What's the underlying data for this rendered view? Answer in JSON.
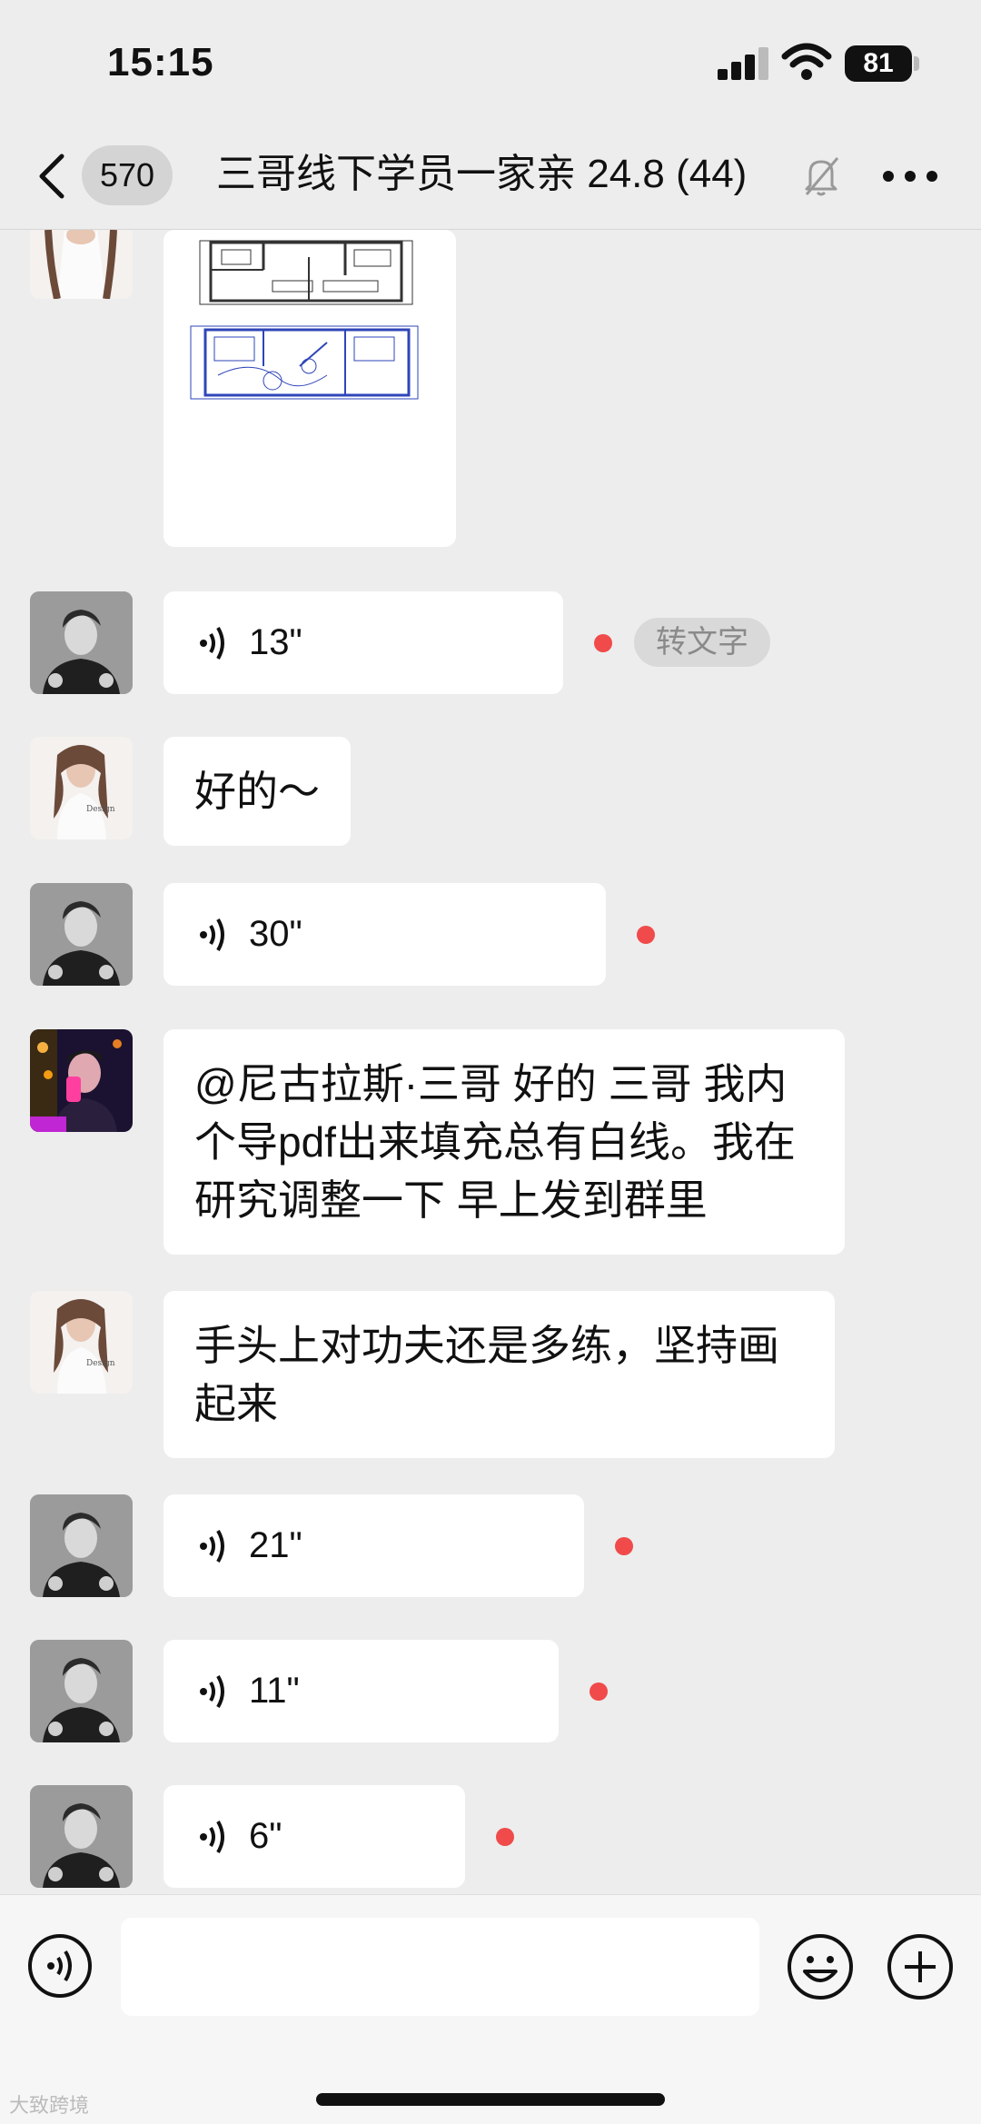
{
  "status": {
    "time": "15:15",
    "battery": "81"
  },
  "header": {
    "unread_count": "570",
    "title": "三哥线下学员一家亲 24.8 (44)"
  },
  "messages": [
    {
      "type": "image",
      "sender": "female"
    },
    {
      "type": "voice",
      "sender": "sange",
      "duration": "13\"",
      "unread": true,
      "to_text": "转文字"
    },
    {
      "type": "text",
      "sender": "female",
      "text": "好的～"
    },
    {
      "type": "voice",
      "sender": "sange",
      "duration": "30\"",
      "unread": true
    },
    {
      "type": "text",
      "sender": "student",
      "text": "@尼古拉斯·三哥  好的 三哥 我内个导pdf出来填充总有白线。我在研究调整一下 早上发到群里"
    },
    {
      "type": "text",
      "sender": "female",
      "text": "手头上对功夫还是多练，坚持画起来"
    },
    {
      "type": "voice",
      "sender": "sange",
      "duration": "21\"",
      "unread": true
    },
    {
      "type": "voice",
      "sender": "sange",
      "duration": "11\"",
      "unread": true
    },
    {
      "type": "voice",
      "sender": "sange",
      "duration": "6\"",
      "unread": true
    }
  ],
  "input": {
    "value": ""
  },
  "watermark": "大致跨境",
  "colors": {
    "background": "#ededed",
    "bubble": "#ffffff",
    "unread_dot": "#f04a4a"
  }
}
